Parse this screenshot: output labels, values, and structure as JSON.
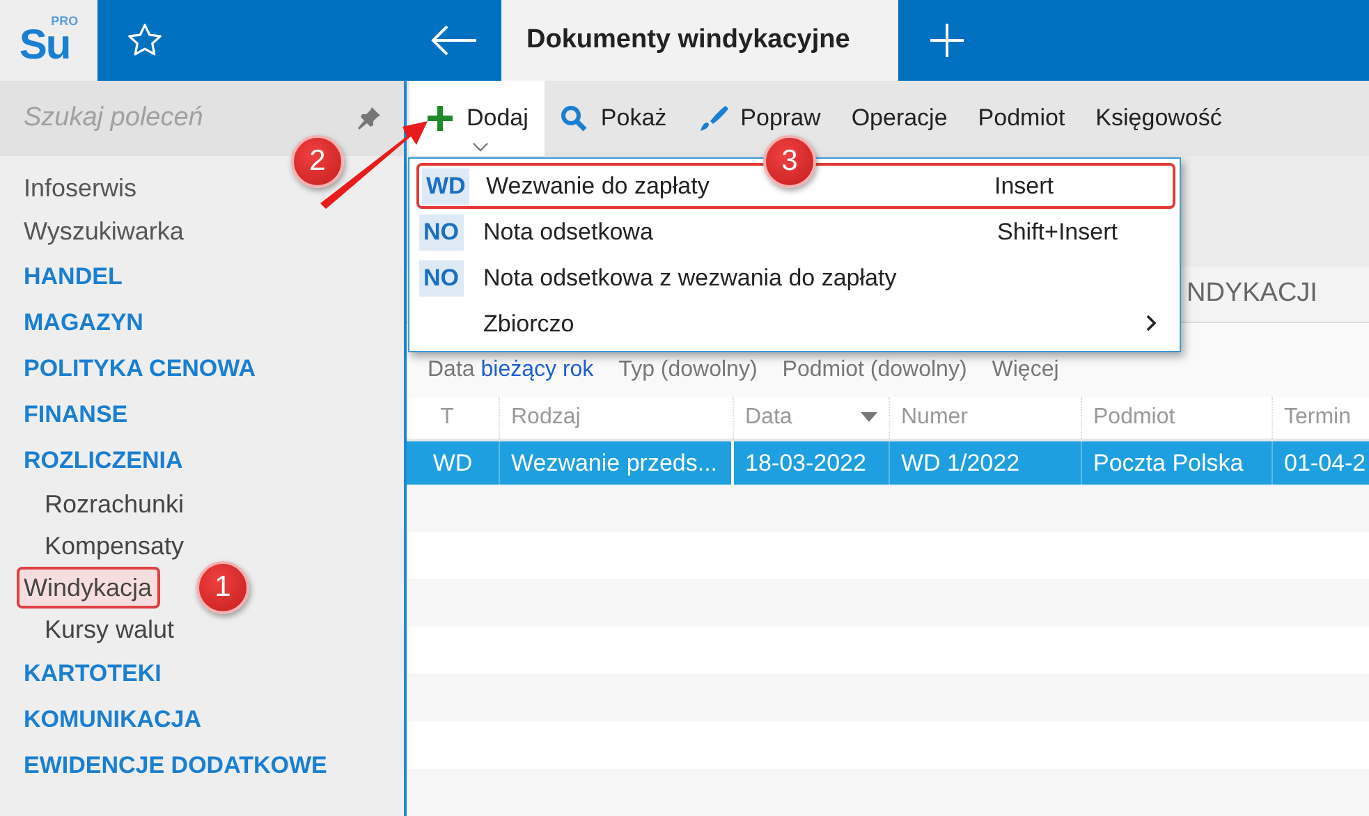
{
  "logo": {
    "text": "Su",
    "superscript": "PRO"
  },
  "tab": {
    "title": "Dokumenty windykacyjne",
    "selected": true
  },
  "sidebar": {
    "search": {
      "placeholder": "Szukaj poleceń"
    },
    "items": [
      {
        "kind": "link",
        "label": "Infoserwis",
        "selected": false
      },
      {
        "kind": "link",
        "label": "Wyszukiwarka",
        "selected": false
      },
      {
        "kind": "section",
        "label": "HANDEL",
        "selected": false
      },
      {
        "kind": "section",
        "label": "MAGAZYN",
        "selected": false
      },
      {
        "kind": "section",
        "label": "POLITYKA CENOWA",
        "selected": false
      },
      {
        "kind": "section",
        "label": "FINANSE",
        "selected": false
      },
      {
        "kind": "section",
        "label": "ROZLICZENIA",
        "selected": false
      },
      {
        "kind": "sub",
        "label": "Rozrachunki",
        "selected": false
      },
      {
        "kind": "sub",
        "label": "Kompensaty",
        "selected": false
      },
      {
        "kind": "sub",
        "label": "Windykacja",
        "selected": true
      },
      {
        "kind": "sub",
        "label": "Kursy walut",
        "selected": false
      },
      {
        "kind": "section",
        "label": "KARTOTEKI",
        "selected": false
      },
      {
        "kind": "section",
        "label": "KOMUNIKACJA",
        "selected": false
      },
      {
        "kind": "section",
        "label": "EWIDENCJE DODATKOWE",
        "selected": false
      }
    ]
  },
  "toolbar": {
    "buttons": [
      {
        "kind": "add",
        "label": "Dodaj",
        "selected": true
      },
      {
        "kind": "search",
        "label": "Pokaż",
        "selected": false
      },
      {
        "kind": "brush",
        "label": "Popraw",
        "selected": false
      },
      {
        "kind": "text",
        "label": "Operacje",
        "selected": false
      },
      {
        "kind": "text",
        "label": "Podmiot",
        "selected": false
      },
      {
        "kind": "text",
        "label": "Księgowość",
        "selected": false
      }
    ]
  },
  "menu": {
    "items": [
      {
        "code": "WD",
        "label": "Wezwanie do zapłaty",
        "shortcut": "Insert",
        "submenu": false,
        "highlighted": true
      },
      {
        "code": "NO",
        "label": "Nota odsetkowa",
        "shortcut": "Shift+Insert",
        "submenu": false,
        "highlighted": false
      },
      {
        "code": "NO",
        "label": "Nota odsetkowa z wezwania do zapłaty",
        "submenu": false,
        "highlighted": false
      },
      {
        "label": "Zbiorczo",
        "submenu": true,
        "highlighted": false
      }
    ]
  },
  "section_header": {
    "title": "NDYKACJI"
  },
  "filters": [
    {
      "label": "Data",
      "value": "bieżący rok"
    },
    {
      "label": "Typ (dowolny)"
    },
    {
      "label": "Podmiot (dowolny)"
    },
    {
      "label": "Więcej"
    }
  ],
  "table": {
    "columns": [
      {
        "label": "T",
        "sorted": false
      },
      {
        "label": "Rodzaj",
        "sorted": false
      },
      {
        "label": "Data",
        "sorted": true
      },
      {
        "label": "Numer",
        "sorted": false
      },
      {
        "label": "Podmiot",
        "sorted": false
      },
      {
        "label": "Termin",
        "sorted": false
      }
    ],
    "rows": [
      {
        "selected": true,
        "cells": [
          "WD",
          "Wezwanie przeds...",
          "18-03-2022",
          "WD 1/2022",
          "Poczta Polska",
          "01-04-2"
        ]
      }
    ]
  },
  "callouts": [
    {
      "label": "1"
    },
    {
      "label": "2"
    },
    {
      "label": "3"
    }
  ]
}
